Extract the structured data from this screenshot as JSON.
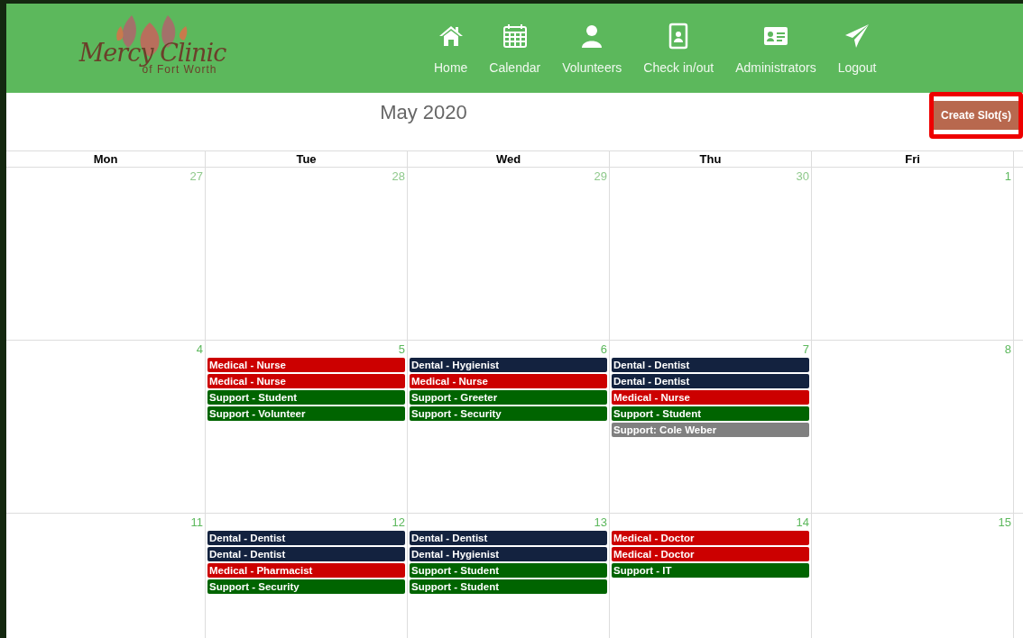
{
  "logo": {
    "name": "Mercy Clinic",
    "subtitle": "of Fort Worth"
  },
  "nav": [
    {
      "label": "Home"
    },
    {
      "label": "Calendar"
    },
    {
      "label": "Volunteers"
    },
    {
      "label": "Check in/out"
    },
    {
      "label": "Administrators"
    },
    {
      "label": "Logout"
    }
  ],
  "calendar": {
    "title": "May 2020",
    "create_button": "Create Slot(s)",
    "days": [
      "Mon",
      "Tue",
      "Wed",
      "Thu",
      "Fri"
    ],
    "weeks": [
      [
        {
          "date": "27",
          "muted": true
        },
        {
          "date": "28",
          "muted": true
        },
        {
          "date": "29",
          "muted": true
        },
        {
          "date": "30",
          "muted": true
        },
        {
          "date": "1",
          "muted": false
        }
      ],
      [
        {
          "date": "4",
          "muted": false
        },
        {
          "date": "5",
          "muted": false,
          "events": [
            {
              "label": "Medical - Nurse",
              "color": "#cc0000"
            },
            {
              "label": "Medical - Nurse",
              "color": "#cc0000"
            },
            {
              "label": "Support - Student",
              "color": "#006400"
            },
            {
              "label": "Support - Volunteer",
              "color": "#006400"
            }
          ]
        },
        {
          "date": "6",
          "muted": false,
          "events": [
            {
              "label": "Dental - Hygienist",
              "color": "#13223f"
            },
            {
              "label": "Medical - Nurse",
              "color": "#cc0000"
            },
            {
              "label": "Support - Greeter",
              "color": "#006400"
            },
            {
              "label": "Support - Security",
              "color": "#006400"
            }
          ]
        },
        {
          "date": "7",
          "muted": false,
          "events": [
            {
              "label": "Dental - Dentist",
              "color": "#13223f"
            },
            {
              "label": "Dental - Dentist",
              "color": "#13223f"
            },
            {
              "label": "Medical - Nurse",
              "color": "#cc0000"
            },
            {
              "label": "Support - Student",
              "color": "#006400"
            },
            {
              "label": "Support: Cole Weber",
              "color": "#808080"
            }
          ]
        },
        {
          "date": "8",
          "muted": false
        }
      ],
      [
        {
          "date": "11",
          "muted": false
        },
        {
          "date": "12",
          "muted": false,
          "events": [
            {
              "label": "Dental - Dentist",
              "color": "#13223f"
            },
            {
              "label": "Dental - Dentist",
              "color": "#13223f"
            },
            {
              "label": "Medical - Pharmacist",
              "color": "#cc0000"
            },
            {
              "label": "Support - Security",
              "color": "#006400"
            }
          ]
        },
        {
          "date": "13",
          "muted": false,
          "events": [
            {
              "label": "Dental - Dentist",
              "color": "#13223f"
            },
            {
              "label": "Dental - Hygienist",
              "color": "#13223f"
            },
            {
              "label": "Support - Student",
              "color": "#006400"
            },
            {
              "label": "Support - Student",
              "color": "#006400"
            }
          ]
        },
        {
          "date": "14",
          "muted": false,
          "events": [
            {
              "label": "Medical - Doctor",
              "color": "#cc0000"
            },
            {
              "label": "Medical - Doctor",
              "color": "#cc0000"
            },
            {
              "label": "Support - IT",
              "color": "#006400"
            }
          ]
        },
        {
          "date": "15",
          "muted": false
        }
      ]
    ]
  }
}
